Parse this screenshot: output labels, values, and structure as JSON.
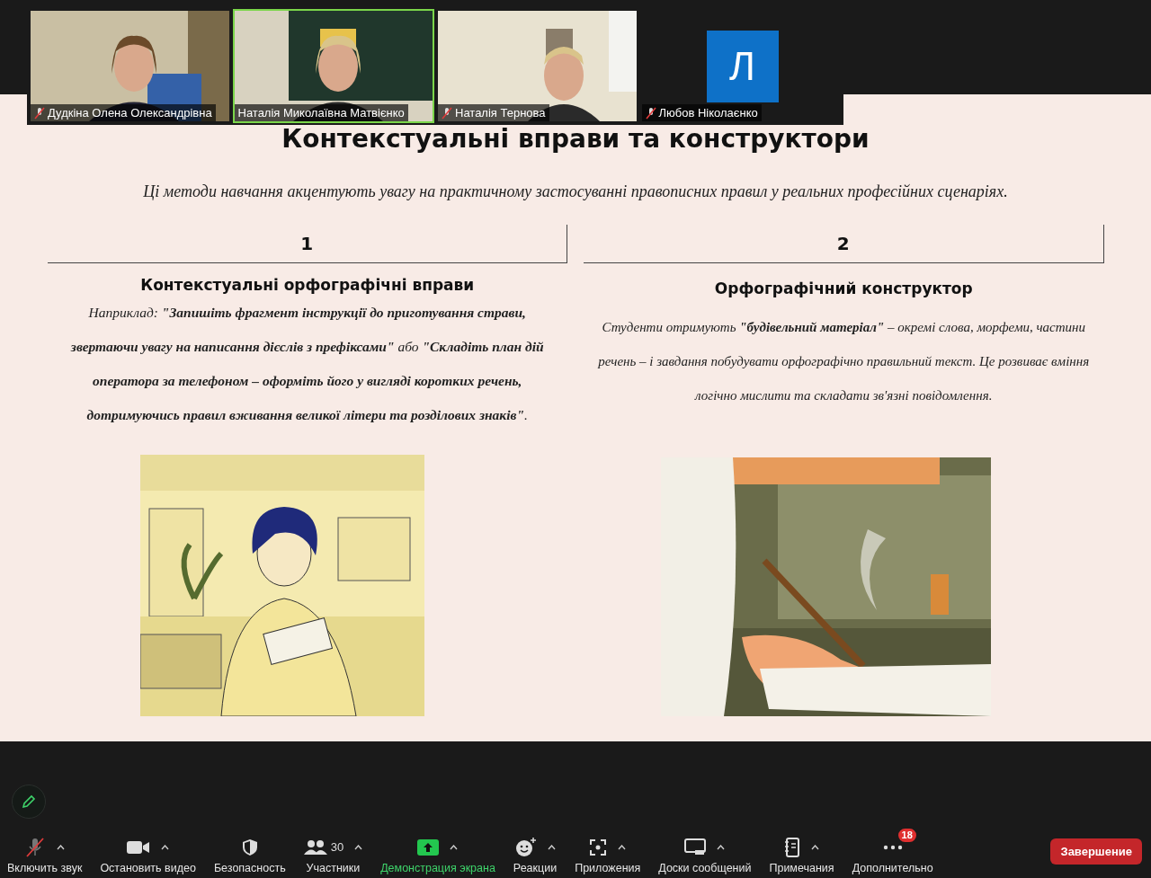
{
  "participants": [
    {
      "name": "Дудкіна Олена Олександрівна",
      "muted": true,
      "speaking": false,
      "kind": "video"
    },
    {
      "name": "Наталія Миколаївна Матвієнко",
      "muted": false,
      "speaking": true,
      "kind": "video"
    },
    {
      "name": "Наталія Тернова",
      "muted": true,
      "speaking": false,
      "kind": "video"
    },
    {
      "name": "Любов Ніколаєнко",
      "muted": true,
      "speaking": false,
      "kind": "avatar",
      "initial": "Л"
    }
  ],
  "slide": {
    "title": "Контекстуальні вправи та конструктори",
    "subtitle": "Ці методи навчання акцентують увагу на практичному застосуванні правописних правил у реальних професійних сценаріях.",
    "columns": [
      {
        "number": "1",
        "heading": "Контекстуальні орфографічні вправи",
        "text": "Наприклад: **\"Запишіть фрагмент інструкції до приготування страви, звертаючи увагу на написання дієслів з префіксами\"** або **\"Складіть план дій оператора за телефоном – оформіть його у вигляді коротких речень, дотримуючись правил вживання великої літери та розділових знаків\"**."
      },
      {
        "number": "2",
        "heading": "Орфографічний конструктор",
        "text": "Студенти отримують **\"будівельний матеріал\"** – окремі слова, морфеми, частини речень – і завдання побудувати орфографічно правильний текст. Це розвиває вміння логічно мислити та складати зв'язні повідомлення."
      }
    ]
  },
  "toolbar": [
    {
      "kind": "mic",
      "label": "Включить звук",
      "muted": true,
      "caret": true
    },
    {
      "kind": "video",
      "label": "Остановить видео",
      "caret": true
    },
    {
      "kind": "security",
      "label": "Безопасность",
      "caret": false
    },
    {
      "kind": "participants",
      "label": "Участники",
      "count": "30",
      "caret": true
    },
    {
      "kind": "share",
      "label": "Демонстрация экрана",
      "caret": true
    },
    {
      "kind": "reactions",
      "label": "Реакции",
      "caret": true
    },
    {
      "kind": "apps",
      "label": "Приложения",
      "caret": true
    },
    {
      "kind": "whiteboards",
      "label": "Доски сообщений",
      "caret": true
    },
    {
      "kind": "notes",
      "label": "Примечания",
      "caret": true
    },
    {
      "kind": "more",
      "label": "Дополнительно",
      "badge": "18",
      "caret": false
    }
  ],
  "leave_button": "Завершение"
}
